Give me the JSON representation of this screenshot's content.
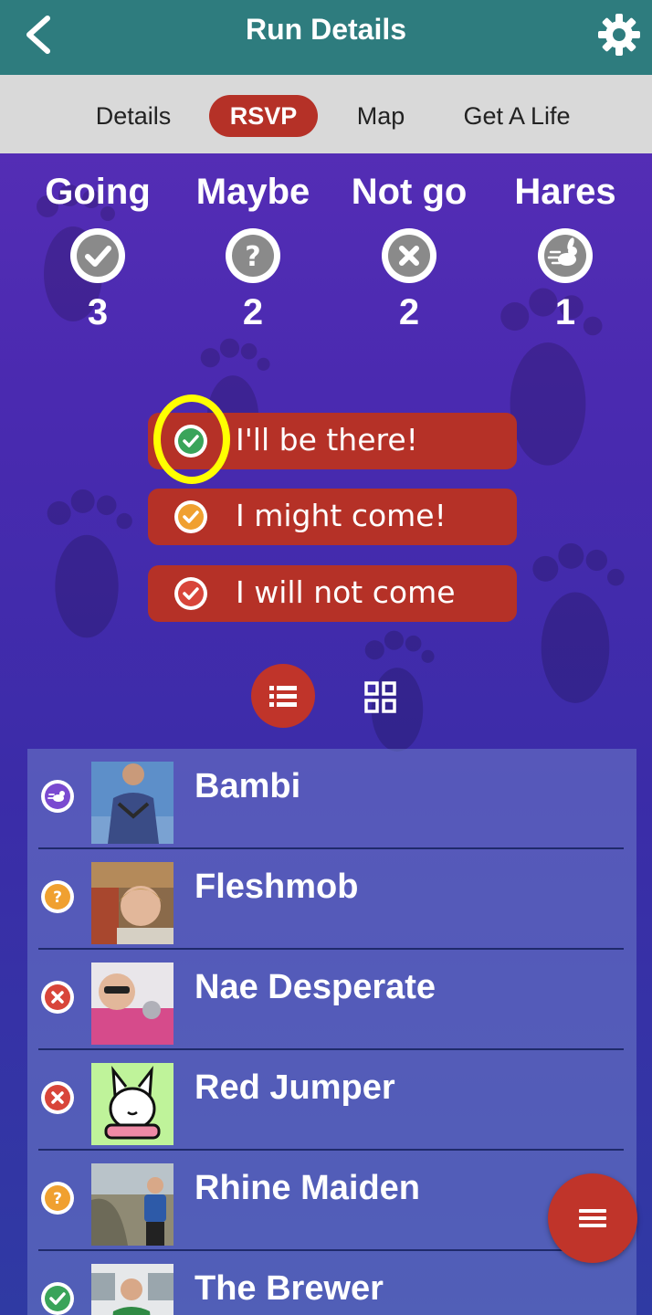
{
  "header": {
    "title": "Run Details",
    "back_icon": "chevron-left-icon",
    "settings_icon": "gear-icon"
  },
  "tabs": [
    {
      "label": "Details",
      "active": false
    },
    {
      "label": "RSVP",
      "active": true
    },
    {
      "label": "Map",
      "active": false
    },
    {
      "label": "Get A Life",
      "active": false
    }
  ],
  "stats": [
    {
      "label": "Going",
      "count": "3",
      "icon": "check-circle-icon"
    },
    {
      "label": "Maybe",
      "count": "2",
      "icon": "question-circle-icon"
    },
    {
      "label": "Not go",
      "count": "2",
      "icon": "x-circle-icon"
    },
    {
      "label": "Hares",
      "count": "1",
      "icon": "hare-icon"
    }
  ],
  "rsvp_buttons": [
    {
      "label": "I'll be there!",
      "icon": "check-circle-icon",
      "icon_color": "#3aa45a"
    },
    {
      "label": "I might come!",
      "icon": "check-circle-icon",
      "icon_color": "#f0a030"
    },
    {
      "label": "I will not come",
      "icon": "check-circle-icon",
      "icon_color": "#d8453a"
    }
  ],
  "view_toggle": {
    "list_icon": "list-icon",
    "grid_icon": "grid-icon",
    "active": "list"
  },
  "members": [
    {
      "name": "Bambi",
      "status": "hare"
    },
    {
      "name": "Fleshmob",
      "status": "maybe"
    },
    {
      "name": "Nae Desperate",
      "status": "not-going"
    },
    {
      "name": "Red Jumper",
      "status": "not-going"
    },
    {
      "name": "Rhine Maiden",
      "status": "maybe"
    },
    {
      "name": "The Brewer",
      "status": "going"
    }
  ],
  "colors": {
    "header": "#2e7c7e",
    "tabs_bg": "#d9d9d9",
    "accent_red": "#b53127",
    "going": "#3aa45a",
    "maybe": "#f0a030",
    "not_going": "#d8453a",
    "hare": "#7a4ad0"
  },
  "fab": {
    "icon": "menu-icon"
  }
}
